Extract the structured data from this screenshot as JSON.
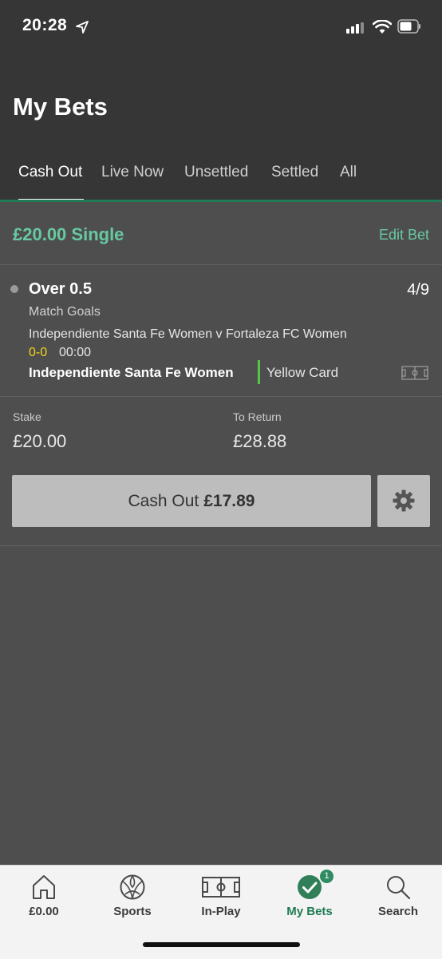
{
  "status_bar": {
    "time": "20:28"
  },
  "page": {
    "title": "My Bets"
  },
  "tabs": [
    {
      "label": "Cash Out",
      "active": true
    },
    {
      "label": "Live Now"
    },
    {
      "label": "Unsettled"
    },
    {
      "label": "Settled"
    },
    {
      "label": "All"
    }
  ],
  "bet": {
    "title": "£20.00 Single",
    "edit_label": "Edit Bet",
    "selection": "Over 0.5",
    "odds": "4/9",
    "market": "Match Goals",
    "event": "Independiente Santa Fe Women v Fortaleza FC Women",
    "score": "0-0",
    "clock": "00:00",
    "incident_team": "Independiente Santa Fe Women",
    "incident": "Yellow Card",
    "stake_label": "Stake",
    "stake": "£20.00",
    "return_label": "To Return",
    "return_value": "£28.88",
    "cashout_label": "Cash Out",
    "cashout_amount": "£17.89"
  },
  "bottom_nav": [
    {
      "label": "£0.00",
      "icon": "home-icon"
    },
    {
      "label": "Sports",
      "icon": "football-icon"
    },
    {
      "label": "In-Play",
      "icon": "pitch-icon"
    },
    {
      "label": "My Bets",
      "icon": "check-icon",
      "badge": "1",
      "active": true
    },
    {
      "label": "Search",
      "icon": "search-icon"
    }
  ],
  "colors": {
    "accent_green": "#67c9a2",
    "brand_green": "#1f7a55",
    "score_yellow": "#f5d515",
    "incident_bar": "#56c74a"
  }
}
